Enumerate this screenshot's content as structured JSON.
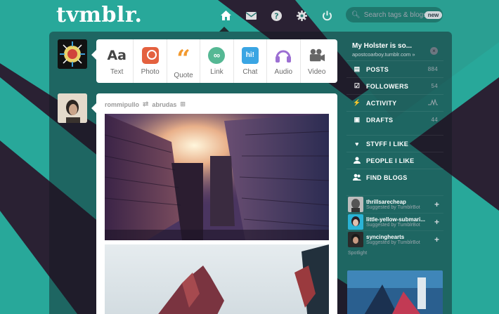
{
  "app": {
    "logo": "tvmblr.",
    "accent": "#28a89a",
    "background": "#2a2133"
  },
  "nav": {
    "icons": [
      {
        "name": "home-icon",
        "glyph": "⌂",
        "active": true
      },
      {
        "name": "mail-icon",
        "glyph": "✉"
      },
      {
        "name": "help-icon",
        "glyph": "?"
      },
      {
        "name": "gear-icon",
        "glyph": "⚙"
      },
      {
        "name": "power-icon",
        "glyph": "⏻"
      }
    ]
  },
  "search": {
    "placeholder": "Search tags & blogs",
    "badge": "new"
  },
  "composer": {
    "types": [
      {
        "label": "Text",
        "icon": "text-icon",
        "glyph": "Aa"
      },
      {
        "label": "Photo",
        "icon": "camera-icon",
        "glyph": ""
      },
      {
        "label": "Quote",
        "icon": "quote-icon",
        "glyph": "“"
      },
      {
        "label": "Link",
        "icon": "link-icon",
        "glyph": "∞"
      },
      {
        "label": "Chat",
        "icon": "chat-icon",
        "glyph": "hi!"
      },
      {
        "label": "Audio",
        "icon": "headphones-icon",
        "glyph": "🎧"
      },
      {
        "label": "Video",
        "icon": "video-camera-icon",
        "glyph": "🎥"
      }
    ]
  },
  "post": {
    "author": "rommipullo",
    "reblogged_from": "abrudas"
  },
  "sidebar": {
    "blog_title": "My Holster is so...",
    "blog_url": "apostcoarboy.tumblr.com »",
    "stats": [
      {
        "label": "POSTS",
        "count": "884",
        "icon": "posts-icon",
        "glyph": "▤"
      },
      {
        "label": "FOLLOWERS",
        "count": "54",
        "icon": "followers-icon",
        "glyph": "☑"
      },
      {
        "label": "ACTIVITY",
        "count": "",
        "icon": "activity-icon",
        "glyph": "⚡"
      },
      {
        "label": "DRAFTS",
        "count": "44",
        "icon": "drafts-icon",
        "glyph": "▣"
      }
    ],
    "links": [
      {
        "label": "STVFF I LIKE",
        "icon": "heart-icon",
        "glyph": "♥"
      },
      {
        "label": "PEOPLE I LIKE",
        "icon": "person-icon",
        "glyph": "👤"
      },
      {
        "label": "FIND BLOGS",
        "icon": "find-people-icon",
        "glyph": "👥"
      }
    ],
    "suggestions": [
      {
        "name": "thrillsarecheap",
        "by": "Suggested by TumblrBot"
      },
      {
        "name": "little-yellow-submari...",
        "by": "Suggested by TumblrBot"
      },
      {
        "name": "syncinghearts",
        "by": "Suggested by TumblrBot"
      }
    ],
    "spotlight_label": "Spotlight"
  }
}
